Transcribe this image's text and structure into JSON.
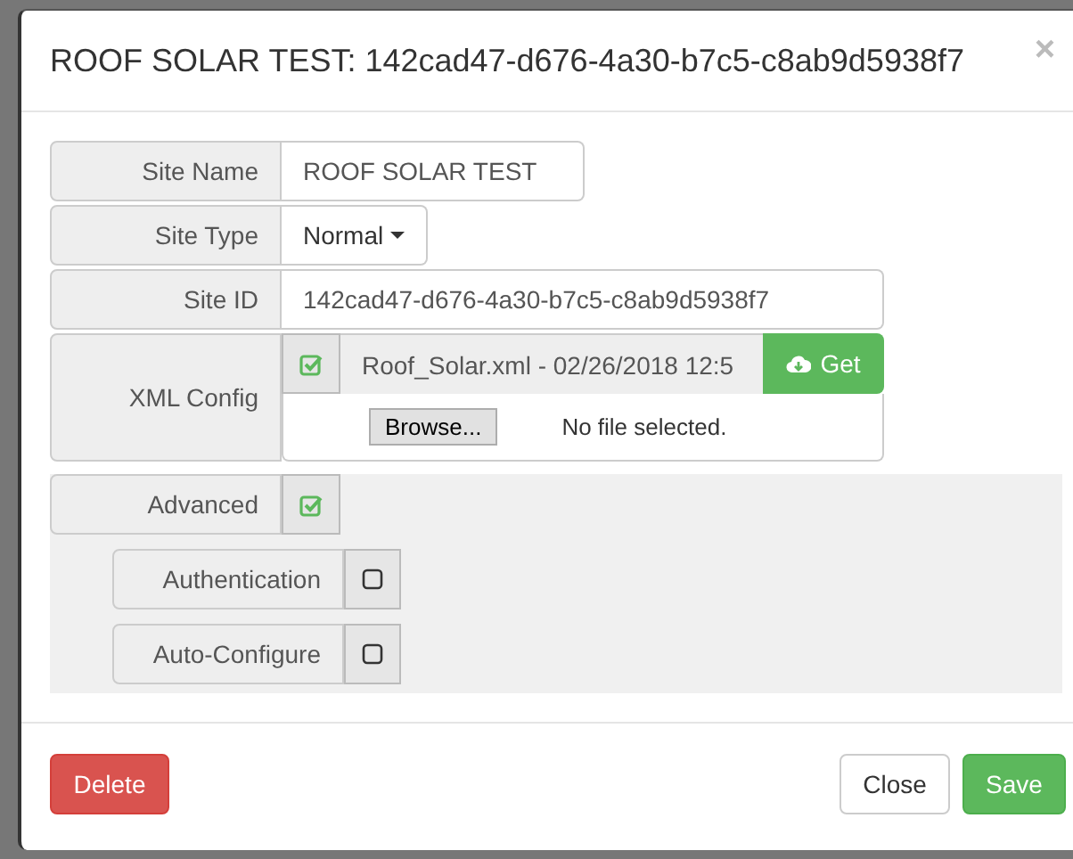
{
  "dialog": {
    "title": "ROOF SOLAR TEST: 142cad47-d676-4a30-b7c5-c8ab9d5938f7",
    "close": "×"
  },
  "site_name": {
    "label": "Site Name",
    "value": "ROOF SOLAR TEST"
  },
  "site_type": {
    "label": "Site Type",
    "value": "Normal"
  },
  "site_id": {
    "label": "Site ID",
    "value": "142cad47-d676-4a30-b7c5-c8ab9d5938f7"
  },
  "xml_config": {
    "label": "XML Config",
    "checked": true,
    "file": "Roof_Solar.xml - 02/26/2018 12:5",
    "get_button": "Get",
    "browse_button": "Browse...",
    "file_status": "No file selected."
  },
  "advanced": {
    "label": "Advanced",
    "checked": true,
    "options": [
      {
        "label": "Authentication",
        "checked": false
      },
      {
        "label": "Auto-Configure",
        "checked": false
      }
    ]
  },
  "footer": {
    "delete": "Delete",
    "close": "Close",
    "save": "Save"
  }
}
